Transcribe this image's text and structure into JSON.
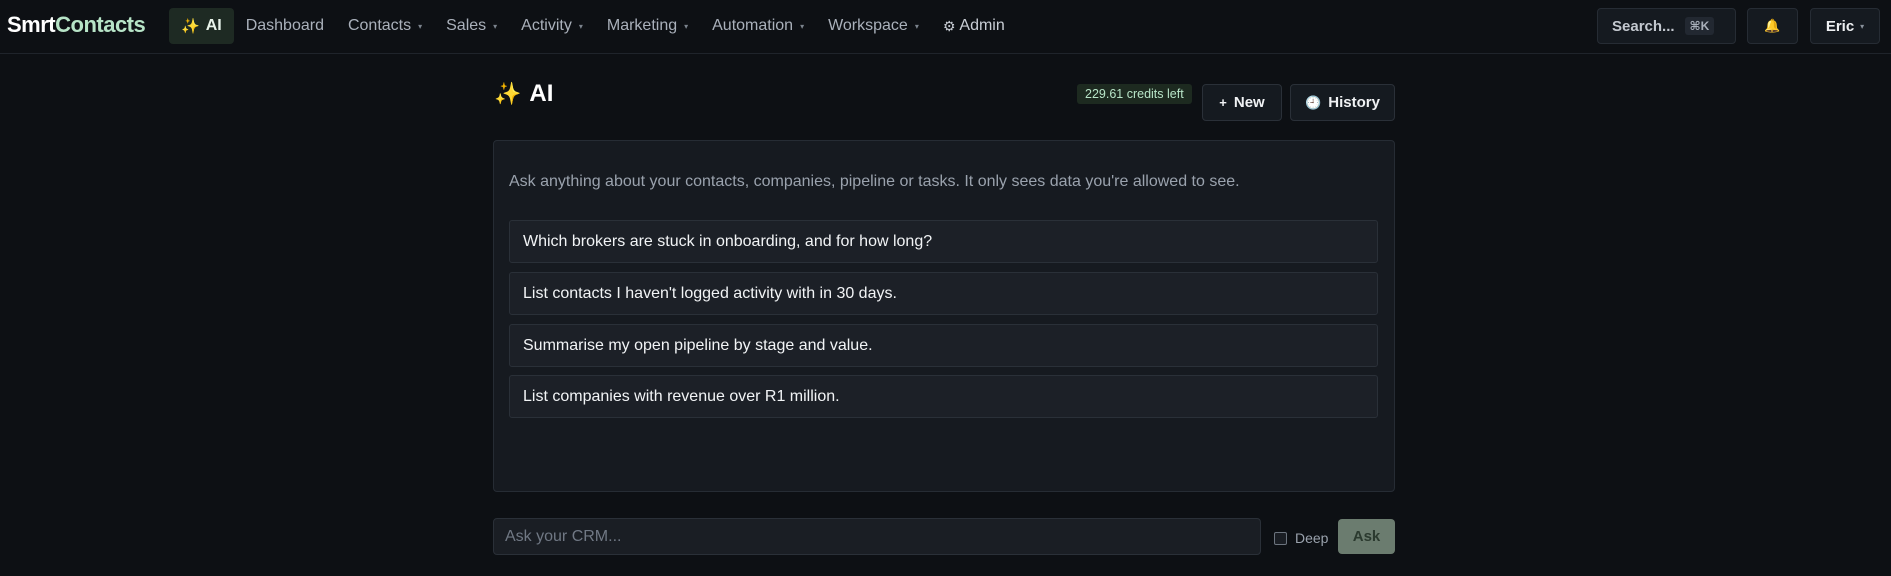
{
  "brand": {
    "part1": "Smrt",
    "part2": "Contacts"
  },
  "nav": {
    "items": [
      {
        "label": "AI",
        "icon": "sparkles-icon",
        "glyph": "✨",
        "active": true
      },
      {
        "label": "Dashboard"
      },
      {
        "label": "Contacts",
        "caret": "▾"
      },
      {
        "label": "Sales",
        "caret": "▾"
      },
      {
        "label": "Activity",
        "caret": "▾"
      },
      {
        "label": "Marketing",
        "caret": "▾"
      },
      {
        "label": "Automation",
        "caret": "▾"
      },
      {
        "label": "Workspace",
        "caret": "▾"
      },
      {
        "label": "Admin",
        "icon": "gear-icon",
        "glyph": "⚙"
      }
    ]
  },
  "topbar": {
    "search_label": "Search...",
    "search_shortcut": "⌘K",
    "bell_glyph": "🔔",
    "user_name": "Eric",
    "user_caret": "▾"
  },
  "page": {
    "title_icon": "✨",
    "title": "AI",
    "credits": "229.61 credits left",
    "new_icon": "+",
    "new_label": "New",
    "history_icon": "🕘",
    "history_label": "History"
  },
  "chat": {
    "intro": "Ask anything about your contacts, companies, pipeline or tasks. It only sees data you're allowed to see.",
    "suggestions": [
      "Which brokers are stuck in onboarding, and for how long?",
      "List contacts I haven't logged activity with in 30 days.",
      "Summarise my open pipeline by stage and value.",
      "List companies with revenue over R1 million."
    ]
  },
  "composer": {
    "placeholder": "Ask your CRM...",
    "value": "",
    "deep_label": "Deep",
    "deep_checked": false,
    "ask_label": "Ask"
  },
  "colors": {
    "background": "#0d1014",
    "accent_green": "#b7e4c7",
    "ask_button": "#6b7c6f"
  }
}
